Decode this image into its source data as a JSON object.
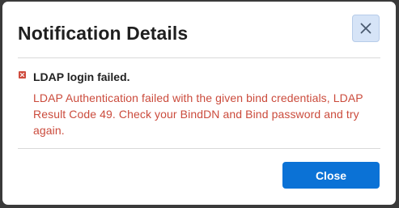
{
  "dialog": {
    "title": "Notification Details",
    "close_icon": "close-x-icon"
  },
  "notification": {
    "status_icon": "error-icon",
    "status_color": "#cf4b3d",
    "title": "LDAP login failed.",
    "message": "LDAP Authentication failed with the given bind credentials, LDAP Result Code 49. Check your BindDN and Bind password and try again."
  },
  "footer": {
    "close_label": "Close",
    "accent_color": "#0b72d6"
  }
}
